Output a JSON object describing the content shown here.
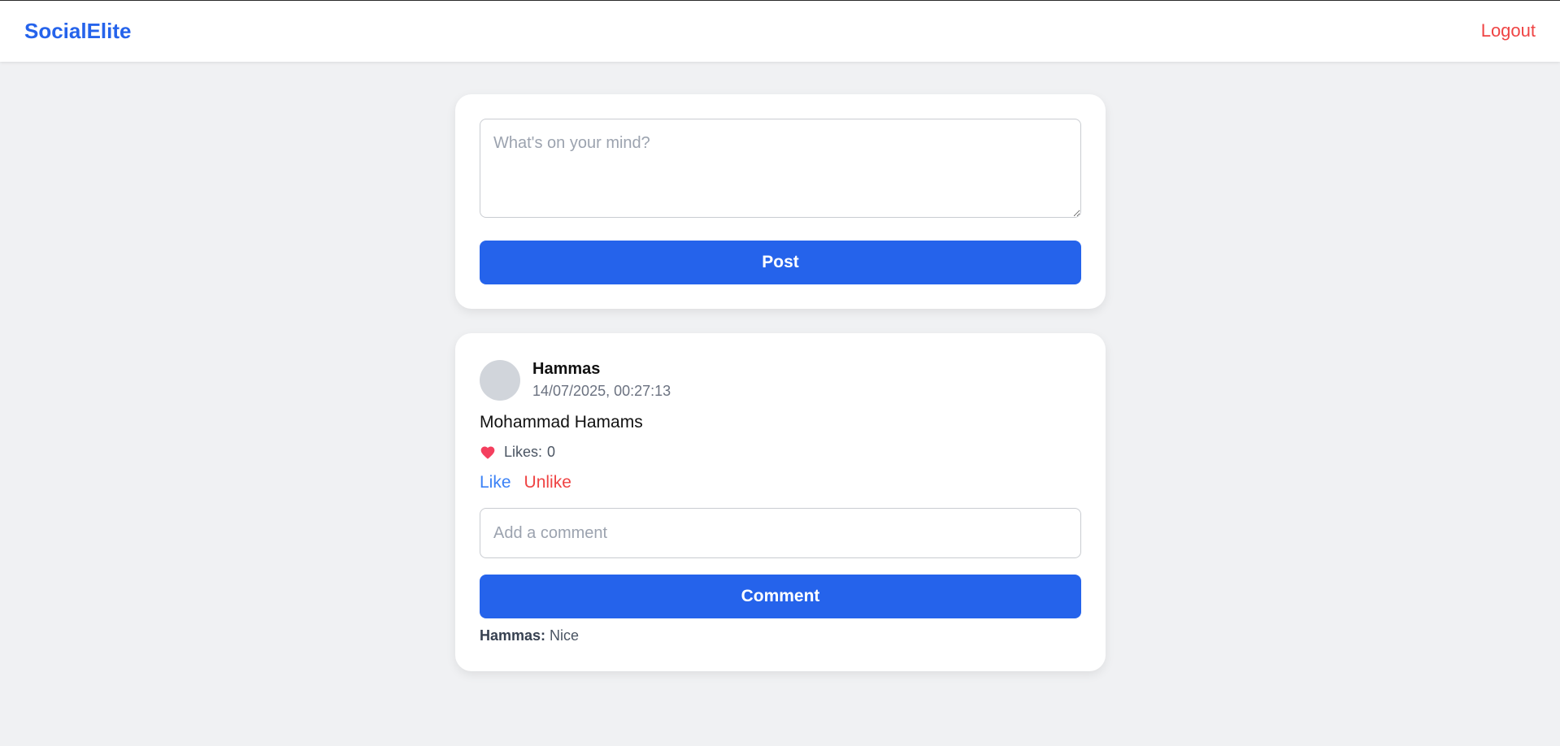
{
  "header": {
    "brand": "SocialElite",
    "logout_label": "Logout"
  },
  "composer": {
    "placeholder": "What's on your mind?",
    "value": "",
    "post_label": "Post"
  },
  "post": {
    "author": "Hammas",
    "timestamp": "14/07/2025, 00:27:13",
    "content": "Mohammad Hamams",
    "likes_label": "Likes:",
    "likes_count": "0",
    "like_label": "Like",
    "unlike_label": "Unlike",
    "comment_placeholder": "Add a comment",
    "comment_value": "",
    "comment_button_label": "Comment",
    "comments": [
      {
        "author": "Hammas:",
        "text": "Nice"
      }
    ]
  },
  "icons": {
    "like": "heart-icon",
    "avatar": "avatar-placeholder"
  },
  "colors": {
    "brand": "#2563eb",
    "primary_button": "#2563eb",
    "logout": "#ef4444",
    "like": "#3b82f6",
    "unlike": "#ef4444",
    "heart": "#f43f5e",
    "page_background": "#f0f1f3",
    "avatar": "#d1d5db"
  }
}
